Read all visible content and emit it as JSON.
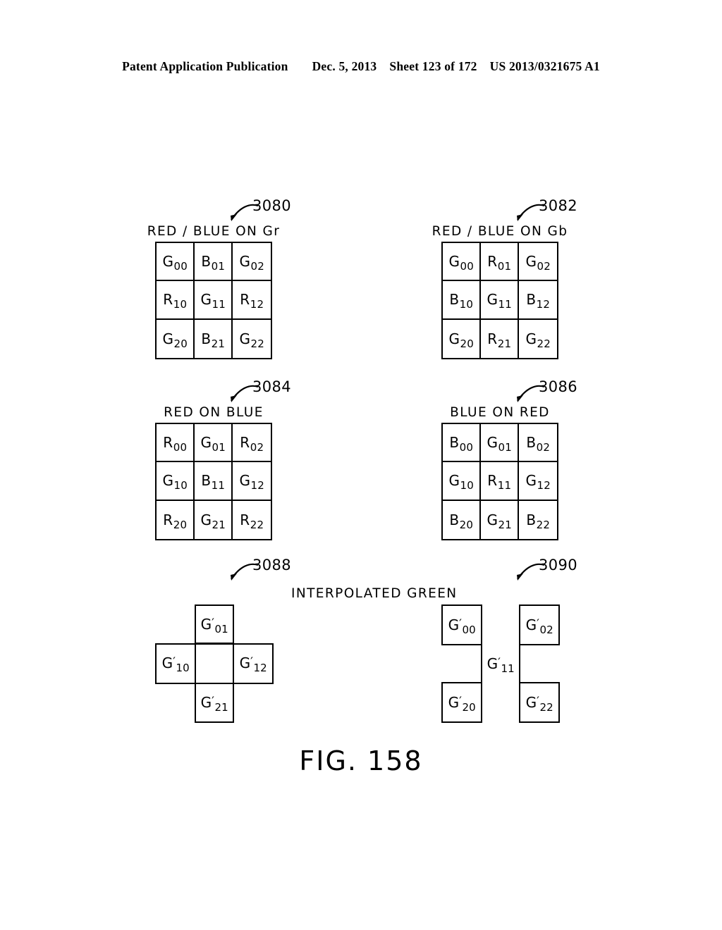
{
  "header": {
    "publication": "Patent Application Publication",
    "date": "Dec. 5, 2013",
    "sheet": "Sheet 123 of 172",
    "patent_number": "US 2013/0321675 A1"
  },
  "figure": {
    "number": "FIG. 158",
    "interpolated_green_label": "INTERPOLATED  GREEN"
  },
  "panels": [
    {
      "ref": "3080",
      "caption": "RED / BLUE  ON  Gr",
      "type": "grid3",
      "cells": [
        {
          "letter": "G",
          "sub": "00"
        },
        {
          "letter": "B",
          "sub": "01"
        },
        {
          "letter": "G",
          "sub": "02"
        },
        {
          "letter": "R",
          "sub": "10"
        },
        {
          "letter": "G",
          "sub": "11"
        },
        {
          "letter": "R",
          "sub": "12"
        },
        {
          "letter": "G",
          "sub": "20"
        },
        {
          "letter": "B",
          "sub": "21"
        },
        {
          "letter": "G",
          "sub": "22"
        }
      ]
    },
    {
      "ref": "3082",
      "caption": "RED / BLUE  ON  Gb",
      "type": "grid3",
      "cells": [
        {
          "letter": "G",
          "sub": "00"
        },
        {
          "letter": "R",
          "sub": "01"
        },
        {
          "letter": "G",
          "sub": "02"
        },
        {
          "letter": "B",
          "sub": "10"
        },
        {
          "letter": "G",
          "sub": "11"
        },
        {
          "letter": "B",
          "sub": "12"
        },
        {
          "letter": "G",
          "sub": "20"
        },
        {
          "letter": "R",
          "sub": "21"
        },
        {
          "letter": "G",
          "sub": "22"
        }
      ]
    },
    {
      "ref": "3084",
      "caption": "RED  ON  BLUE",
      "type": "grid3",
      "cells": [
        {
          "letter": "R",
          "sub": "00"
        },
        {
          "letter": "G",
          "sub": "01"
        },
        {
          "letter": "R",
          "sub": "02"
        },
        {
          "letter": "G",
          "sub": "10"
        },
        {
          "letter": "B",
          "sub": "11"
        },
        {
          "letter": "G",
          "sub": "12"
        },
        {
          "letter": "R",
          "sub": "20"
        },
        {
          "letter": "G",
          "sub": "21"
        },
        {
          "letter": "R",
          "sub": "22"
        }
      ]
    },
    {
      "ref": "3086",
      "caption": "BLUE  ON  RED",
      "type": "grid3",
      "cells": [
        {
          "letter": "B",
          "sub": "00"
        },
        {
          "letter": "G",
          "sub": "01"
        },
        {
          "letter": "B",
          "sub": "02"
        },
        {
          "letter": "G",
          "sub": "10"
        },
        {
          "letter": "R",
          "sub": "11"
        },
        {
          "letter": "G",
          "sub": "12"
        },
        {
          "letter": "B",
          "sub": "20"
        },
        {
          "letter": "G",
          "sub": "21"
        },
        {
          "letter": "B",
          "sub": "22"
        }
      ]
    },
    {
      "ref": "3088",
      "caption": "",
      "type": "plus",
      "cells": [
        {
          "letter": "G",
          "prime": "′",
          "sub": "01"
        },
        {
          "letter": "G",
          "prime": "′",
          "sub": "10"
        },
        {
          "letter": "G",
          "prime": "′",
          "sub": "12"
        },
        {
          "letter": "G",
          "prime": "′",
          "sub": "21"
        }
      ]
    },
    {
      "ref": "3090",
      "caption": "",
      "type": "corners",
      "cells": [
        {
          "letter": "G",
          "prime": "′",
          "sub": "00"
        },
        {
          "letter": "G",
          "prime": "′",
          "sub": "02"
        },
        {
          "letter": "G",
          "prime": "′",
          "sub": "11"
        },
        {
          "letter": "G",
          "prime": "′",
          "sub": "20"
        },
        {
          "letter": "G",
          "prime": "′",
          "sub": "22"
        }
      ]
    }
  ],
  "colors": {
    "ink": "#000000",
    "paper": "#ffffff"
  }
}
